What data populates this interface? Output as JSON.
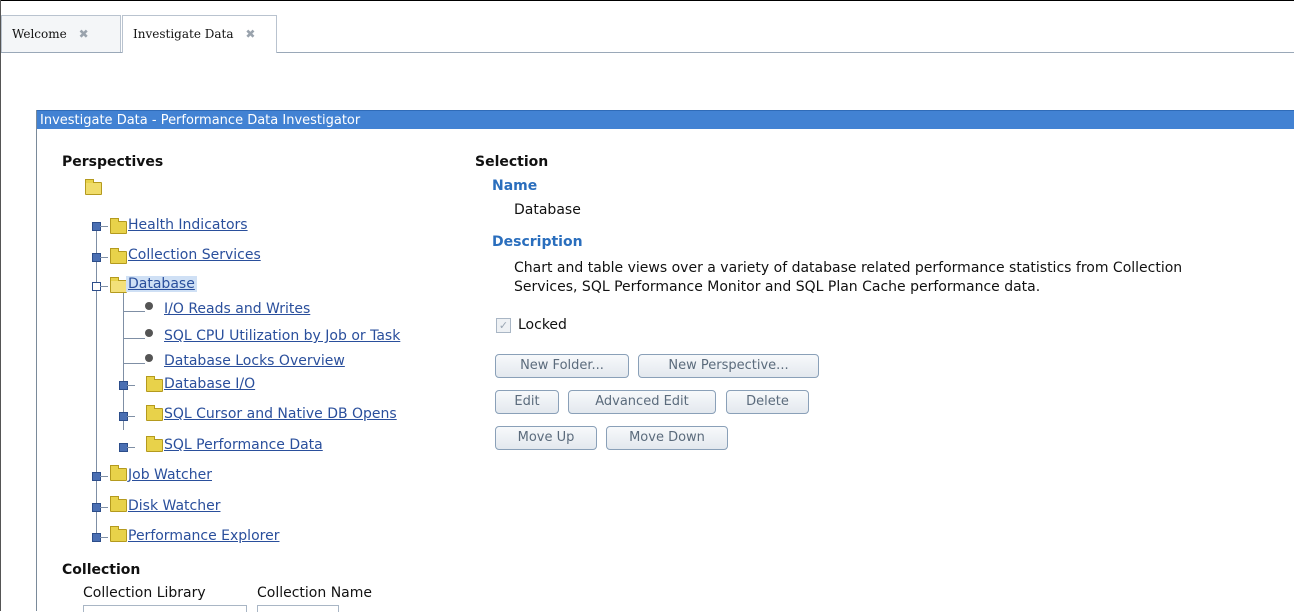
{
  "tabs": [
    {
      "label": "Welcome",
      "close": "✖"
    },
    {
      "label": "Investigate Data",
      "close": "✖"
    }
  ],
  "portlet": {
    "title": "Investigate Data - Performance Data Investigator"
  },
  "perspectives": {
    "heading": "Perspectives",
    "tree": {
      "health": "Health Indicators",
      "collection_services": "Collection Services",
      "database": "Database",
      "io_reads_writes": "I/O Reads and Writes",
      "sql_cpu": "SQL CPU Utilization by Job or Task",
      "db_locks": "Database Locks Overview",
      "database_io": "Database I/O",
      "sql_cursor": "SQL Cursor and Native DB Opens",
      "sql_perf": "SQL Performance Data",
      "job_watcher": "Job Watcher",
      "disk_watcher": "Disk Watcher",
      "perf_explorer": "Performance Explorer"
    }
  },
  "selection": {
    "heading": "Selection",
    "name_label": "Name",
    "name_value": "Database",
    "description_label": "Description",
    "description_line1": "Chart and table views over a variety of database related performance statistics from Collection",
    "description_line2": "Services, SQL Performance Monitor and SQL Plan Cache performance data.",
    "locked_label": "Locked",
    "buttons": {
      "new_folder": "New Folder...",
      "new_perspective": "New Perspective...",
      "edit": "Edit",
      "advanced_edit": "Advanced Edit",
      "delete": "Delete",
      "move_up": "Move Up",
      "move_down": "Move Down"
    }
  },
  "collection": {
    "heading": "Collection",
    "library_label": "Collection Library",
    "name_label": "Collection Name"
  },
  "colors": {
    "title_bar": "#4282d3",
    "link": "#2a4f9c",
    "label_blue": "#2a6ebd"
  }
}
